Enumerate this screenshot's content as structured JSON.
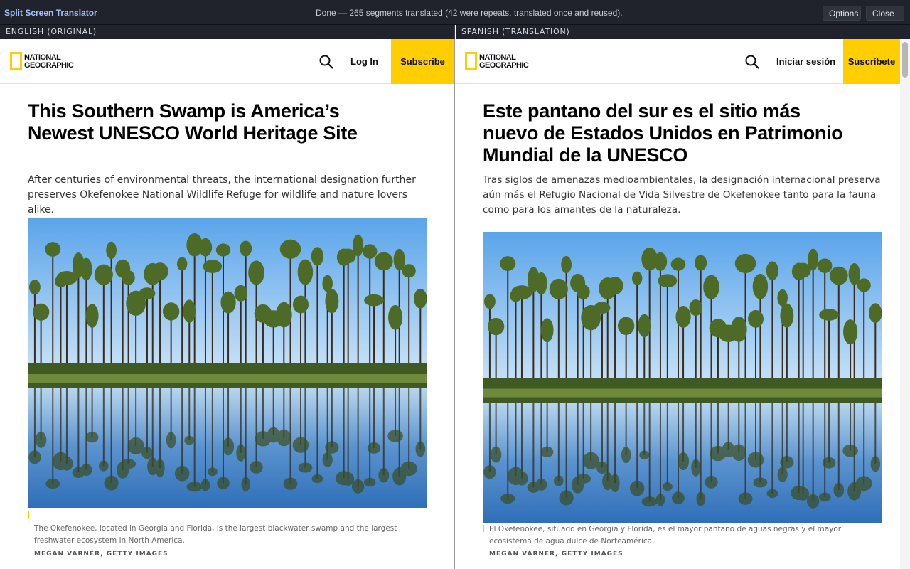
{
  "toolbar": {
    "app_name": "Split Screen Translator",
    "status": "Done — 265 segments translated (42 were repeats, translated once and reused).",
    "options_label": "Options",
    "close_label": "Close ✕"
  },
  "left": {
    "pane_label": "ENGLISH (ORIGINAL)",
    "logo_text": "NATIONAL GEOGRAPHIC",
    "login": "Log In",
    "subscribe": "Subscribe",
    "headline": "This Southern Swamp is America’s Newest UNESCO World Heritage Site",
    "dek": "After centuries of environmental threats, the international designation further preserves Okefenokee National Wildlife Refuge for wildlife and nature lovers alike.",
    "caption": "The Okefenokee, located in Georgia and Florida, is the largest blackwater swamp and the largest freshwater ecosystem in North America.",
    "credit": "MEGAN VARNER, GETTY IMAGES"
  },
  "right": {
    "pane_label": "SPANISH (TRANSLATION)",
    "logo_text": "NATIONAL GEOGRAPHIC",
    "login": "Iniciar sesión",
    "subscribe": "Suscríbete",
    "headline": "Este pantano del sur es el sitio más nuevo de Estados Unidos en Patrimonio Mundial de la UNESCO",
    "dek": "Tras siglos de amenazas medioambientales, la designación internacional preserva aún más el Refugio Nacional de Vida Silvestre de Okefenokee tanto para la fauna como para los amantes de la naturaleza.",
    "caption": "El Okefenokee, situado en Georgia y Florida, es el mayor pantano de aguas negras y el mayor ecosistema de agua dulce de Norteamérica.",
    "credit": "MEGAN VARNER, GETTY IMAGES"
  },
  "colors": {
    "accent_yellow": "#ffce00",
    "toolbar_bg": "#20232b",
    "brand_blue": "#9fc2ff"
  },
  "icons": {
    "search": "search-icon",
    "logo_frame": "natgeo-yellow-frame-icon"
  }
}
